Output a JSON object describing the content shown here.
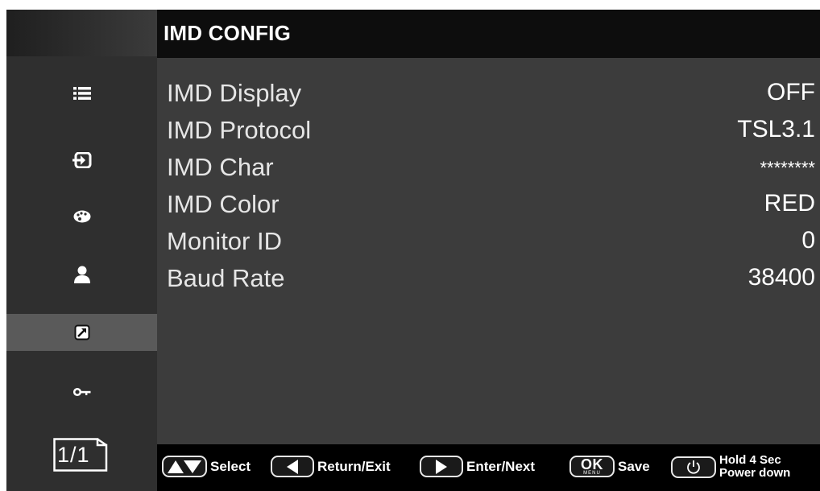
{
  "header": {
    "title": "IMD CONFIG"
  },
  "sidebar": {
    "items": [
      {
        "icon": "list-icon",
        "active": false
      },
      {
        "icon": "input-icon",
        "active": false
      },
      {
        "icon": "palette-icon",
        "active": false
      },
      {
        "icon": "user-icon",
        "active": false
      },
      {
        "icon": "shortcut-icon",
        "active": true
      },
      {
        "icon": "key-icon",
        "active": false
      }
    ],
    "page_indicator": "1/1"
  },
  "menu": {
    "items": [
      {
        "label": "IMD Display",
        "value": "OFF"
      },
      {
        "label": "IMD Protocol",
        "value": "TSL3.1"
      },
      {
        "label": "IMD Char",
        "value": "********"
      },
      {
        "label": "IMD Color",
        "value": "RED"
      },
      {
        "label": "Monitor ID",
        "value": "0"
      },
      {
        "label": "Baud Rate",
        "value": "38400"
      }
    ]
  },
  "footer": {
    "select": "Select",
    "return": "Return/Exit",
    "enter": "Enter/Next",
    "ok_key": "OK",
    "ok_sub": "MENU",
    "save": "Save",
    "power_line1": "Hold 4 Sec",
    "power_line2": "Power down"
  },
  "colors": {
    "background": "#3c3c3c",
    "sidebar": "#2f2f2f",
    "header": "#0d0d0d",
    "active": "#5a5a5a",
    "text": "#ffffff"
  }
}
